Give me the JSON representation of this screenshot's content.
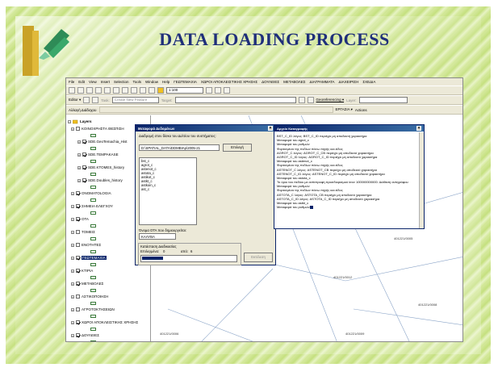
{
  "slide": {
    "title": "DATA LOADING PROCESS"
  },
  "app": {
    "menu": [
      "File",
      "Edit",
      "View",
      "Insert",
      "Selection",
      "Tools",
      "Window",
      "Help",
      "ΓΕΩΤΕΜΑΧΙΑ",
      "ΧΩΡΟΙ ΑΠΟΚΛΕΙΣΤΙΚΗΣ ΧΡΗΣΗΣ",
      "ΔΟΥΛΕΙΕΣ",
      "ΜΕΤΑΒΟΛΕΣ",
      "ΔΙΑΓΡΑΜΜΑΤΑ",
      "ΔΙΑΧΕΙΡΙΣΗ",
      "ΣΧΕΔΙΑ"
    ],
    "toolbar1": {
      "scale_value": "1:100"
    },
    "toolbar2": {
      "editor_label": "Editor ▾",
      "task_label": "Task:",
      "task_value": "Create New Feature",
      "target_label": "Target:",
      "georef_label": "Georeferencing ▾",
      "layer_label": "Layer:"
    },
    "toolbar3": {
      "left_label": "Αλλαγή Διάδοχου",
      "ergasia_label": "ΕΡΓΑΣΙΑ ▾",
      "actions_label": "Actions"
    }
  },
  "toc": {
    "root_label": "Layers",
    "items": [
      {
        "label": "ΚΟΙΝΟΧΡΗΣΤΑ ΘΕΣΠΙΣΗ",
        "checked": false,
        "level": 1
      },
      {
        "label": "SDE.GeoTemachia_Hist",
        "checked": true,
        "level": 2
      },
      {
        "label": "SDE.TEMPAKASE",
        "checked": true,
        "level": 2
      },
      {
        "label": "SDE.KTOMES_history",
        "checked": true,
        "level": 2
      },
      {
        "label": "SDE.Doubles_history",
        "checked": true,
        "level": 2
      },
      {
        "label": "ONOMATOLOGIA",
        "checked": true,
        "level": 1
      },
      {
        "label": "ΣΗΜΕΙΑ ΕΛΕΓΧΟΥ",
        "checked": true,
        "level": 1
      },
      {
        "label": "ΟΤΑ",
        "checked": true,
        "level": 1
      },
      {
        "label": "ΤΟΜΕΙΣ",
        "checked": false,
        "level": 1
      },
      {
        "label": "ΕΝΟΤΗΤΕΣ",
        "checked": false,
        "level": 1
      },
      {
        "label": "ΓΕΩΤΕΜΑΧΙΑ",
        "checked": true,
        "level": 1,
        "selected": true
      },
      {
        "label": "ΚΤΙΡΙΑ",
        "checked": true,
        "level": 1
      },
      {
        "label": "ΜΕΤΑΒΟΛΕΣ",
        "checked": true,
        "level": 1
      },
      {
        "label": "ΑΣΤΙΚΟΠΟΙΗΣΗ",
        "checked": false,
        "level": 1
      },
      {
        "label": "ΑΓΡΟΤΟΚΤΗΣΕΙΩΝ",
        "checked": false,
        "level": 1
      },
      {
        "label": "ΧΩΡΟΙ ΑΠΟΚΛΕΙΣΤΙΚΗΣ ΧΡΗΣΗΣ",
        "checked": true,
        "level": 1
      },
      {
        "label": "ΔΟΥΛΕΙΕΣ",
        "checked": true,
        "level": 1
      }
    ]
  },
  "dialog": {
    "title": "Μεταφορά Δεδομένων",
    "prompt": "Διαδρομή στον δίσκο του Δελτίου του συστήματος:",
    "path_value": "D:\\SPATIAL_DATA\\DDMBIAp\\2005-21",
    "browse_button": "Επιλογή",
    "files": [
      "bst_c",
      "agrot_c",
      "astenot_c",
      "astota_c",
      "astikot_c",
      "astkt_c",
      "astkoin_c",
      "ast_c"
    ],
    "ota_prompt": "Όνομα ΟΤΑ που δημιουργείται:",
    "ota_value": "ΚΑΛΥΒΑ",
    "group_label": "Κατάσταση Διαδικασίας",
    "step_label": "Επιλεγμένα:",
    "step_value": "0",
    "from_label": "από:",
    "from_value": "6",
    "progress_fraction": 0.22,
    "action_button": "Εκτέλεση"
  },
  "log": {
    "title": "Αρχείο Καταγραφής",
    "lines": [
      "BST_C_ID             λόγος: BST_C_ID  περιέχει μη αποδεκτή χαρακτήρα",
      "Μεταφορά του agrot_c",
      "Μεταφορά του ρυθμών",
      "Φορτισμένα της πεδίων πάνω πηγής και είδος",
      "AGROT_C              λόγος: AGROT_C_CB  περιέχει μη αποδεκτό χαρακτήρα",
      "AGROT_C_ID           λόγος: AGROT_C_ID  περιέχει μη αποδεκτό χαρακτήρα",
      "Μεταφορά του astenot_c",
      "Φορτισμένα της πεδίων πάνω πηγής και είδος",
      "ASTENOT_C            λόγος: ASTENOT_CB  περιέχει μη αποδεκτό χαρακτήρα",
      "ASTENOT_C_ID         λόγος: ASTENOT_C_ID  περιέχει μη αποδεκτό χαρακτήρα",
      "Μεταφορά του astota_c",
      "Το όριο του πεδίου με αντίστροφη προσδιορισμού ίσον 100000000000. Διάθεση αντιγράφου",
      "Μεταφορά του ρυθμών",
      "Φορτισμένα της πεδίων πάνω πηγής και είδος",
      "ASTOTA_C             λόγος: ASTOTA_CB  περιέχει μη αποδεκτό χαρακτήρα",
      "ASTOTA_C_ID          λόγος: ASTOTA_C_ID  περιέχει μη αποδεκτό χαρακτήρα",
      "Μεταφορά του astkt_c",
      "Μεταφορά του ρυθμών"
    ]
  },
  "map": {
    "labels": [
      "401221/0012",
      "401221/0005",
      "401221/0006",
      "401221/0009",
      "401221/0008"
    ]
  }
}
